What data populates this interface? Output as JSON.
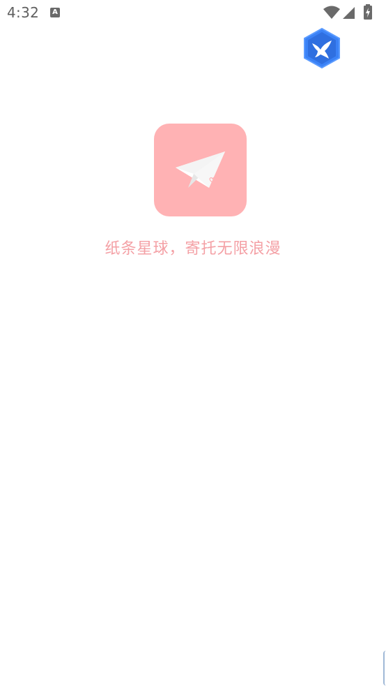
{
  "status_bar": {
    "time": "4:32",
    "notification_icon": "text-a-icon",
    "notification_letter": "A",
    "icons": [
      "wifi-icon",
      "cellular-signal-icon",
      "battery-charging-icon"
    ]
  },
  "corner_badge": {
    "icon": "hexagon-bird-icon",
    "color": "#3b82f6"
  },
  "splash": {
    "logo_icon": "paper-plane-icon",
    "logo_color": "#ffb2b4",
    "slogan": "纸条星球，寄托无限浪漫",
    "slogan_color": "#f4a0a5"
  }
}
